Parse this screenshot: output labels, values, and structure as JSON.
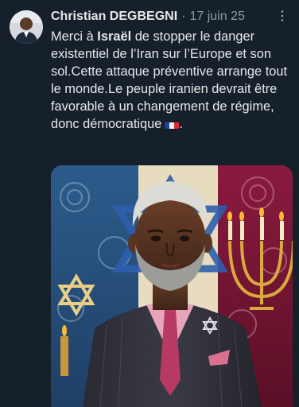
{
  "author": {
    "name": "Christian DEGBEGNI",
    "separator": "·",
    "date": "17 juin 25"
  },
  "tweet": {
    "text_before": "Merci à ",
    "text_bold": "Israël",
    "text_after": " de stopper le danger existentiel de l’Iran sur l’Europe et son sol.Cette attaque préventive arrange tout le monde.Le peuple iranien devrait être favorable à un changement de régime, donc démocratique",
    "flag_icon": "flag-france-icon"
  },
  "menu": {
    "label": "⋮"
  },
  "media": {
    "alt_icon": "ai-portrait-image"
  },
  "colors": {
    "background": "#15202b",
    "text": "#e7e9ea",
    "muted": "#8b98a5",
    "israel_blue": "#2f5d9a",
    "iran_red": "#8e1a3b"
  }
}
